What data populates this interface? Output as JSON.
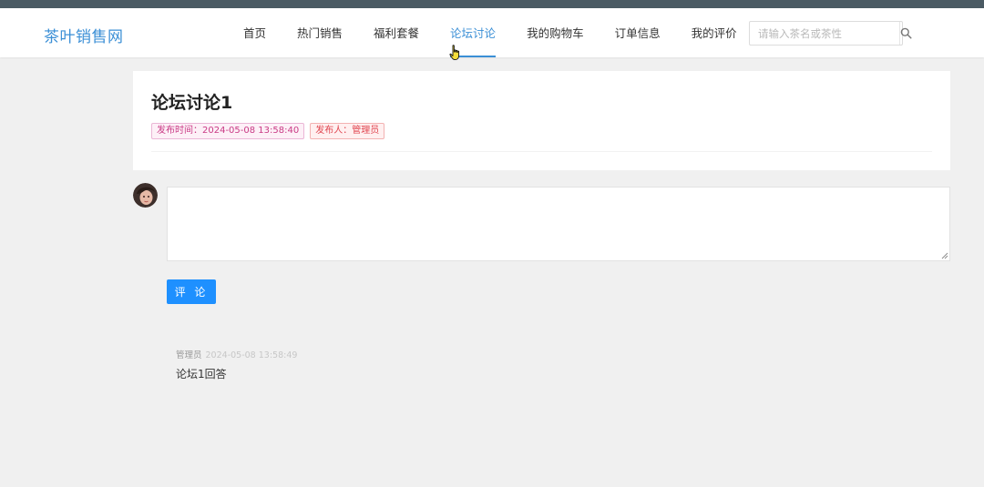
{
  "header": {
    "logo": "茶叶销售网",
    "nav": [
      {
        "label": "首页",
        "active": false
      },
      {
        "label": "热门销售",
        "active": false
      },
      {
        "label": "福利套餐",
        "active": false
      },
      {
        "label": "论坛讨论",
        "active": true
      },
      {
        "label": "我的购物车",
        "active": false
      },
      {
        "label": "订单信息",
        "active": false
      },
      {
        "label": "我的评价",
        "active": false
      }
    ],
    "search": {
      "placeholder": "请输入茶名或茶性",
      "value": "",
      "icon": "search-icon"
    }
  },
  "colors": {
    "accent": "#3b8fd6",
    "topbar": "#4a5a63",
    "button": "#1e90ff",
    "tag_red": "#e0454f",
    "tag_purple": "#c93a85",
    "background": "#f0f0f0"
  },
  "post": {
    "title": "论坛讨论1",
    "publish_time": "发布时间：2024-05-08 13:58:40",
    "publisher": "发布人：管理员"
  },
  "comment_form": {
    "value": "",
    "submit_label": "评 论"
  },
  "replies": [
    {
      "author": "管理员",
      "time": "2024-05-08 13:58:49",
      "content": "论坛1回答"
    }
  ]
}
